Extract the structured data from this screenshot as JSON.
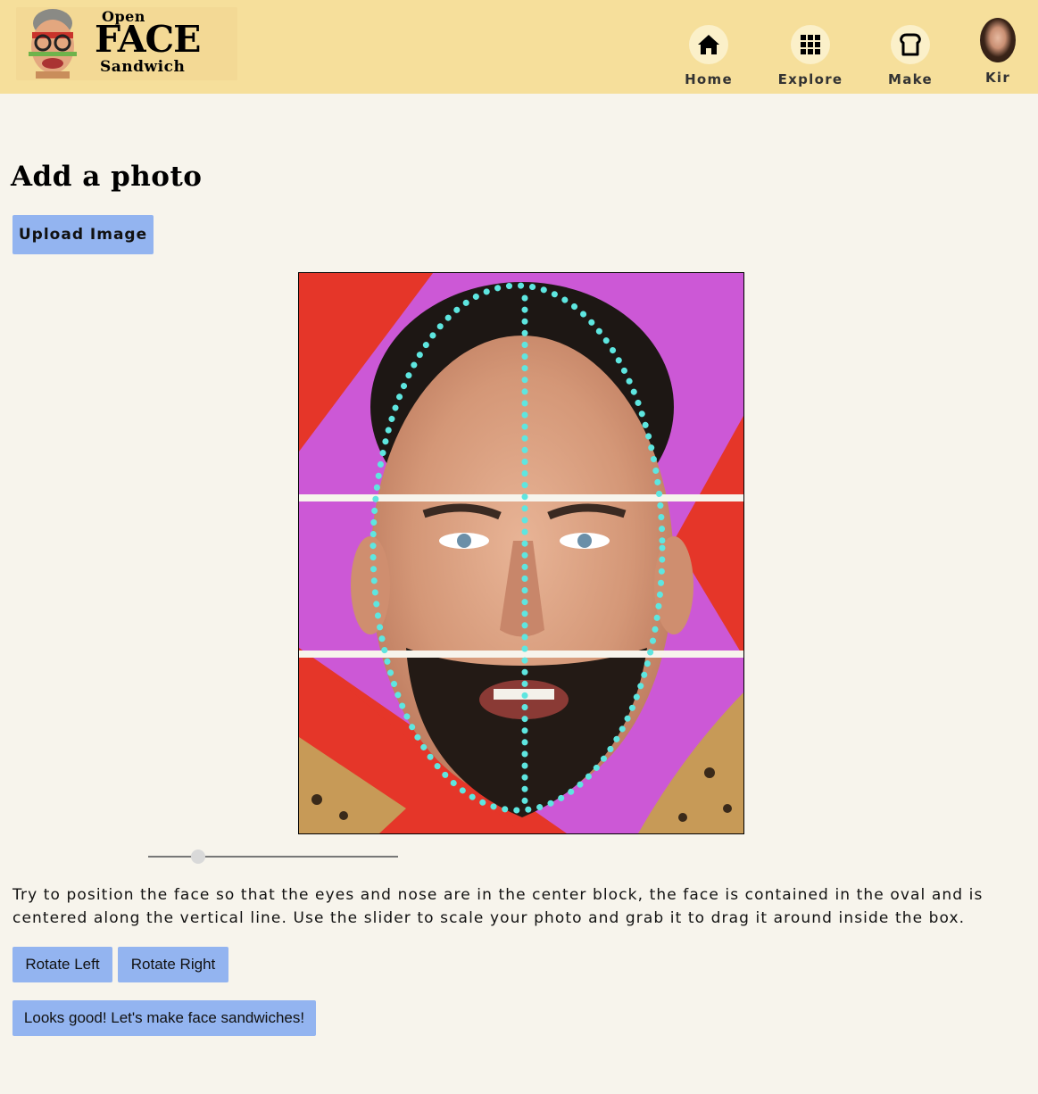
{
  "header": {
    "logo": {
      "line1": "Open",
      "line2": "FACE",
      "line3": "Sandwich"
    },
    "nav": [
      {
        "label": "Home",
        "icon": "home-icon"
      },
      {
        "label": "Explore",
        "icon": "grid-icon"
      },
      {
        "label": "Make",
        "icon": "bread-icon"
      },
      {
        "label": "Kir",
        "icon": "user-avatar"
      }
    ]
  },
  "main": {
    "title": "Add a photo",
    "upload_label": "Upload Image",
    "slider_value": 0.2,
    "instructions": "Try to position the face so that the eyes and nose are in the center block, the face is contained in the oval and is centered along the vertical line. Use the slider to scale your photo and grab it to drag it around inside the box.",
    "rotate_left_label": "Rotate Left",
    "rotate_right_label": "Rotate Right",
    "confirm_label": "Looks good! Let's make face sandwiches!"
  },
  "colors": {
    "header_bg": "#f6df9b",
    "page_bg": "#f7f4ec",
    "button_bg": "#93b4f0",
    "guide_color": "#5ee6e0"
  }
}
